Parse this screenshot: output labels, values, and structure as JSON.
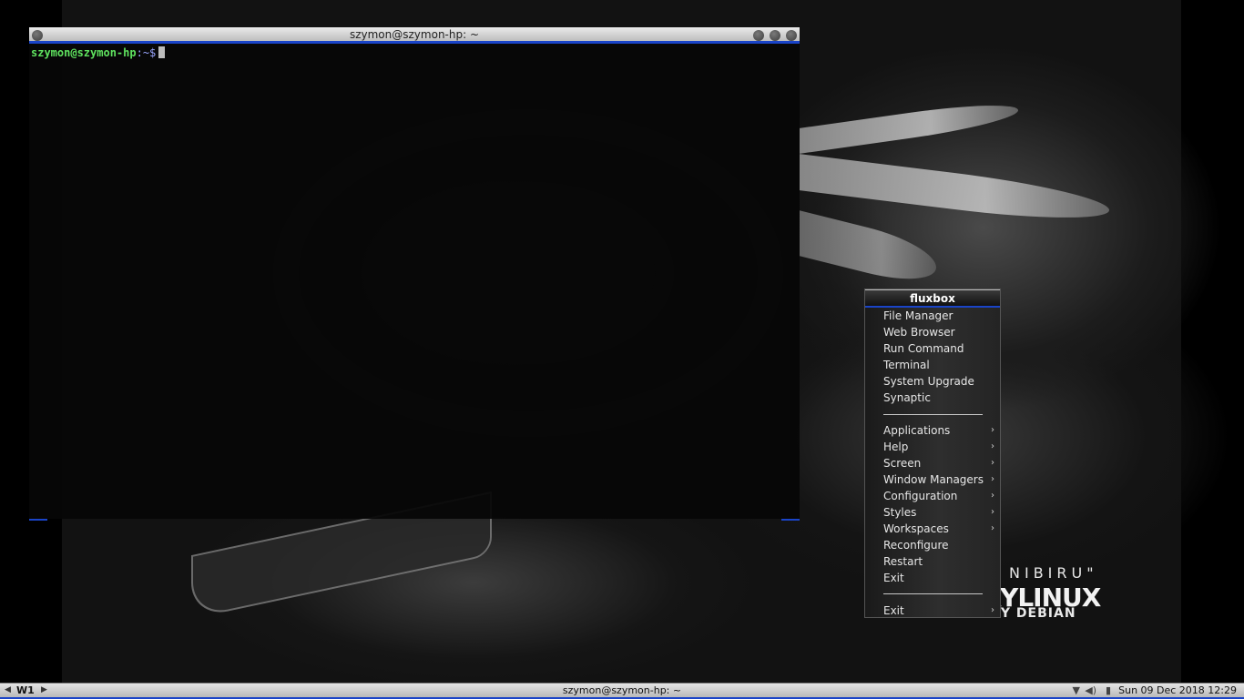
{
  "wallpaper": {
    "brand_line1": "NIBIRU\"",
    "brand_line2": "SPARKYLINUX",
    "brand_line3": "BY DEBIAN"
  },
  "terminal": {
    "title": "szymon@szymon-hp: ~",
    "prompt_user": "szymon@szymon-hp",
    "prompt_path": ":~$"
  },
  "menu": {
    "title": "fluxbox",
    "items": [
      {
        "label": "File Manager"
      },
      {
        "label": "Web Browser"
      },
      {
        "label": "Run Command"
      },
      {
        "label": "Terminal"
      },
      {
        "label": "System Upgrade"
      },
      {
        "label": "Synaptic"
      }
    ],
    "submenus": [
      {
        "label": "Applications"
      },
      {
        "label": "Help"
      },
      {
        "label": "Screen"
      },
      {
        "label": "Window Managers"
      },
      {
        "label": "Configuration"
      },
      {
        "label": "Styles"
      },
      {
        "label": "Workspaces"
      }
    ],
    "actions": [
      {
        "label": "Reconfigure"
      },
      {
        "label": "Restart"
      },
      {
        "label": "Exit"
      }
    ],
    "last_item": {
      "label": "Exit"
    },
    "arrow_glyph": "›"
  },
  "taskbar": {
    "workspace": "W1",
    "task_title": "szymon@szymon-hp: ~",
    "clock": "Sun 09 Dec 2018 12:29",
    "tray_icons": [
      "wifi-icon",
      "volume-icon",
      "battery-icon"
    ]
  },
  "colors": {
    "accent": "#1a44c8",
    "prompt_user": "#5fe35f",
    "prompt_path": "#9aa6ff"
  }
}
